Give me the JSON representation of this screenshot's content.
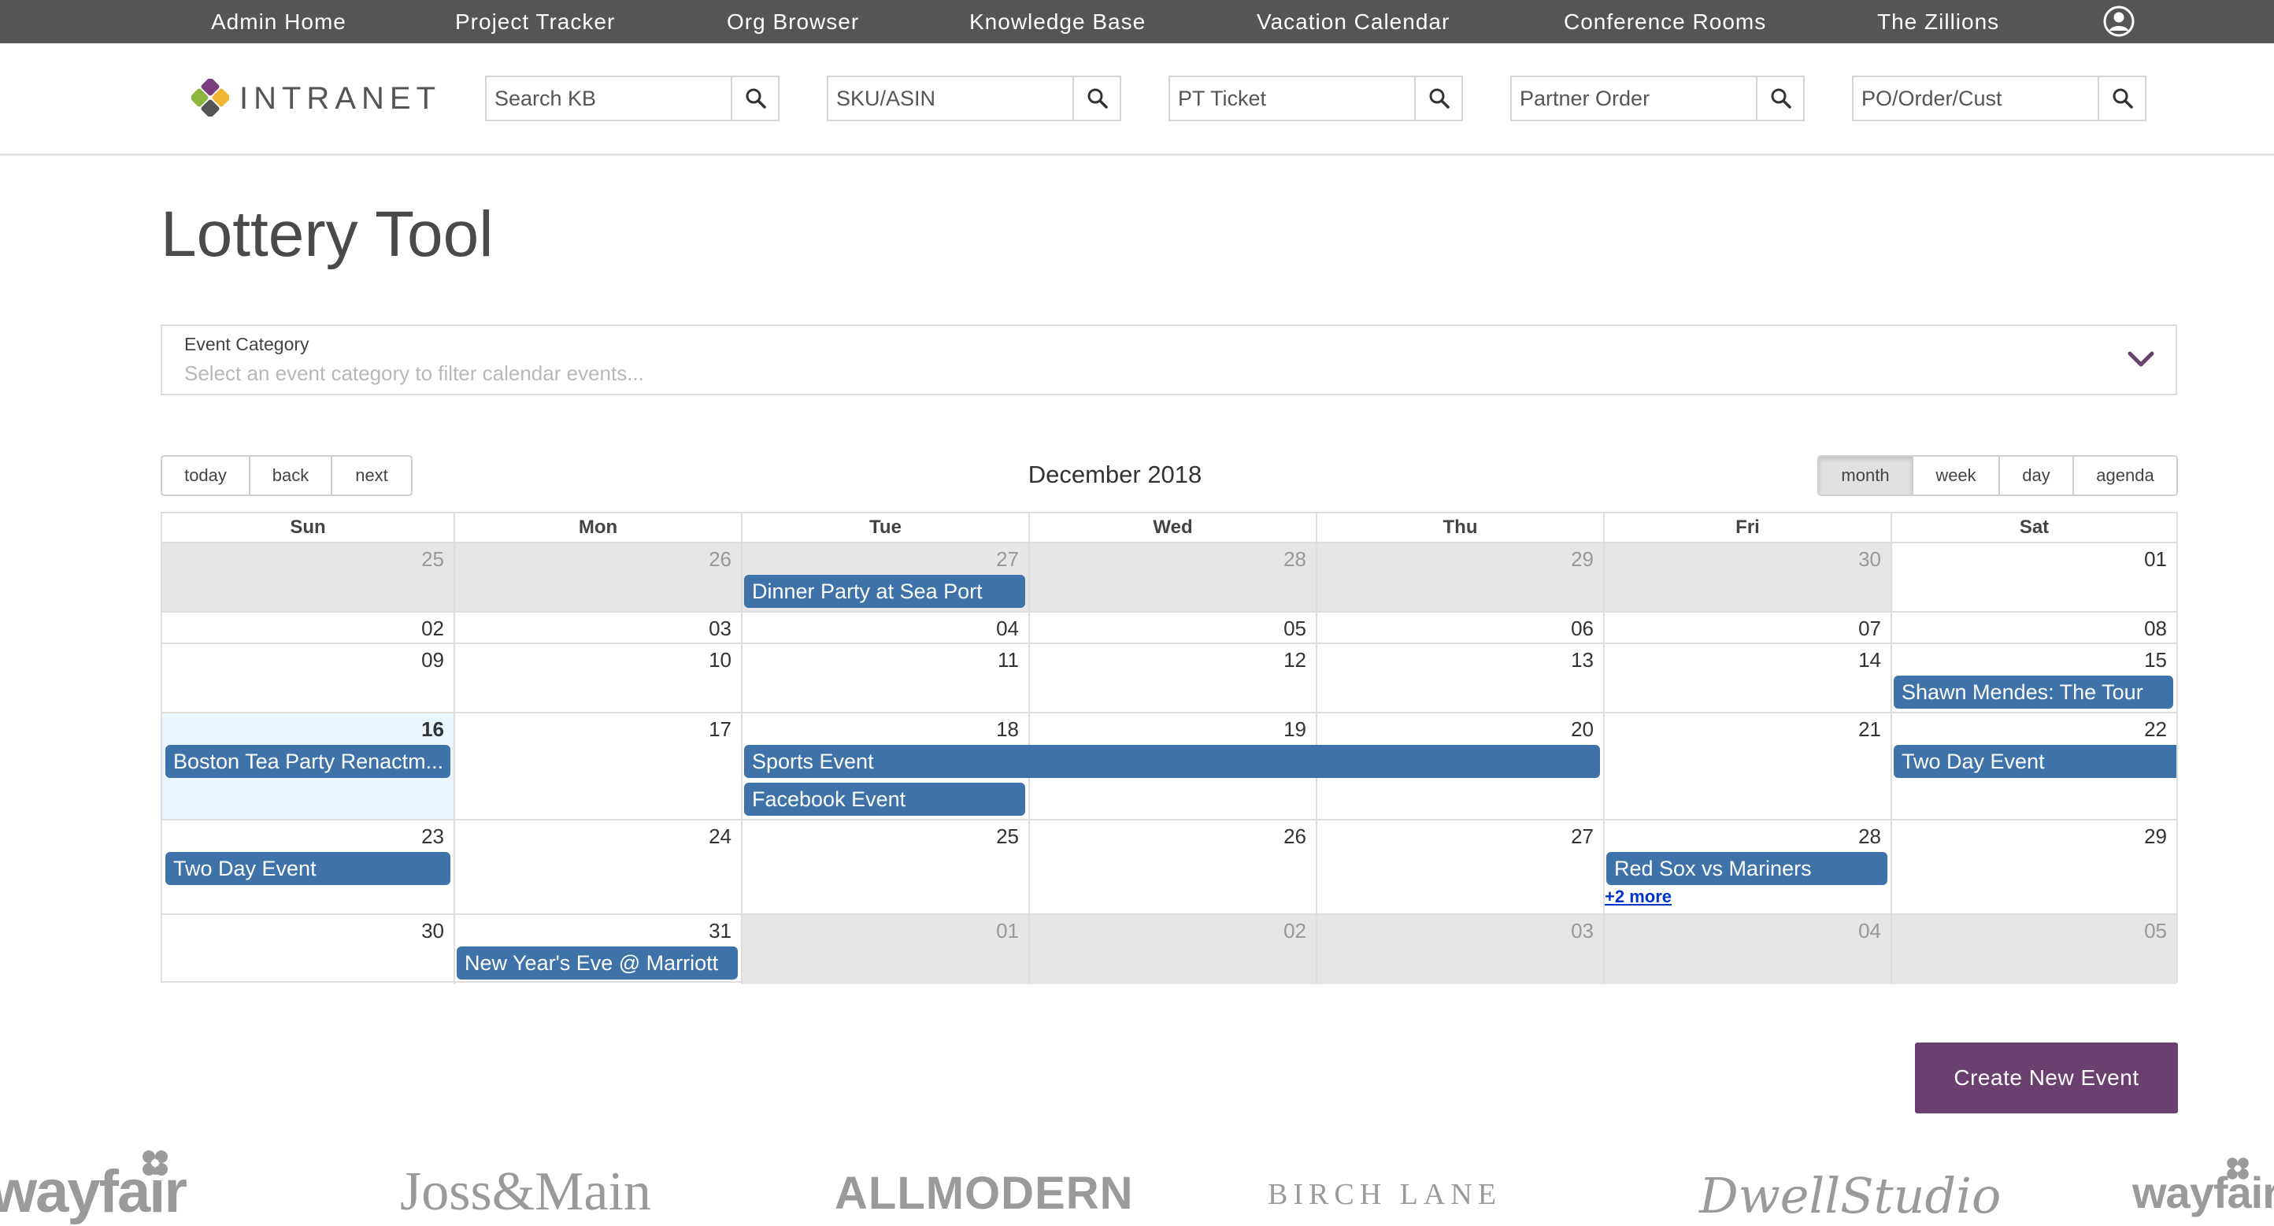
{
  "topnav": {
    "links": [
      "Admin Home",
      "Project Tracker",
      "Org Browser",
      "Knowledge Base",
      "Vacation Calendar",
      "Conference Rooms",
      "The Zillions"
    ],
    "user_icon": "user-icon"
  },
  "header": {
    "logo_text": "INTRANET",
    "searches": [
      {
        "placeholder": "Search KB",
        "icon": "search-icon"
      },
      {
        "placeholder": "SKU/ASIN",
        "icon": "search-icon"
      },
      {
        "placeholder": "PT Ticket",
        "icon": "search-icon"
      },
      {
        "placeholder": "Partner Order",
        "icon": "search-icon"
      },
      {
        "placeholder": "PO/Order/Cust",
        "icon": "search-icon"
      }
    ]
  },
  "page": {
    "title": "Lottery Tool"
  },
  "category": {
    "label": "Event Category",
    "placeholder": "Select an event category to filter calendar events...",
    "icon": "chevron-down-icon"
  },
  "toolbar": {
    "nav": [
      "today",
      "back",
      "next"
    ],
    "label": "December 2018",
    "views": [
      "month",
      "week",
      "day",
      "agenda"
    ],
    "active_view": "month"
  },
  "calendar": {
    "weekdays": [
      "Sun",
      "Mon",
      "Tue",
      "Wed",
      "Thu",
      "Fri",
      "Sat"
    ],
    "today": "16",
    "weeks": [
      {
        "days": [
          {
            "d": "25",
            "off": true
          },
          {
            "d": "26",
            "off": true
          },
          {
            "d": "27",
            "off": true
          },
          {
            "d": "28",
            "off": true
          },
          {
            "d": "29",
            "off": true
          },
          {
            "d": "30",
            "off": true
          },
          {
            "d": "01",
            "off": false
          }
        ],
        "events": [
          {
            "title": "Dinner Party at Sea Port",
            "col": 2,
            "span": 1,
            "lane": 0
          }
        ]
      },
      {
        "days": [
          {
            "d": "02",
            "off": false
          },
          {
            "d": "03",
            "off": false
          },
          {
            "d": "04",
            "off": false
          },
          {
            "d": "05",
            "off": false
          },
          {
            "d": "06",
            "off": false
          },
          {
            "d": "07",
            "off": false
          },
          {
            "d": "08",
            "off": false
          }
        ],
        "events": []
      },
      {
        "days": [
          {
            "d": "09",
            "off": false
          },
          {
            "d": "10",
            "off": false
          },
          {
            "d": "11",
            "off": false
          },
          {
            "d": "12",
            "off": false
          },
          {
            "d": "13",
            "off": false
          },
          {
            "d": "14",
            "off": false
          },
          {
            "d": "15",
            "off": false
          }
        ],
        "events": [
          {
            "title": "Shawn Mendes: The Tour",
            "col": 6,
            "span": 1,
            "lane": 0
          }
        ]
      },
      {
        "days": [
          {
            "d": "16",
            "off": false
          },
          {
            "d": "17",
            "off": false
          },
          {
            "d": "18",
            "off": false
          },
          {
            "d": "19",
            "off": false
          },
          {
            "d": "20",
            "off": false
          },
          {
            "d": "21",
            "off": false
          },
          {
            "d": "22",
            "off": false
          }
        ],
        "events": [
          {
            "title": "Boston Tea Party Renactm...",
            "col": 0,
            "span": 1,
            "lane": 0
          },
          {
            "title": "Sports Event",
            "col": 2,
            "span": 3,
            "lane": 0
          },
          {
            "title": "Two Day Event",
            "col": 6,
            "span": 1,
            "lane": 0,
            "continues": true
          },
          {
            "title": "Facebook Event",
            "col": 2,
            "span": 1,
            "lane": 1
          }
        ]
      },
      {
        "days": [
          {
            "d": "23",
            "off": false
          },
          {
            "d": "24",
            "off": false
          },
          {
            "d": "25",
            "off": false
          },
          {
            "d": "26",
            "off": false
          },
          {
            "d": "27",
            "off": false
          },
          {
            "d": "28",
            "off": false
          },
          {
            "d": "29",
            "off": false
          }
        ],
        "events": [
          {
            "title": "Two Day Event",
            "col": 0,
            "span": 1,
            "lane": 0
          },
          {
            "title": "Red Sox vs Mariners",
            "col": 5,
            "span": 1,
            "lane": 0
          }
        ],
        "more": [
          {
            "label": "+2 more",
            "col": 5
          }
        ]
      },
      {
        "days": [
          {
            "d": "30",
            "off": false
          },
          {
            "d": "31",
            "off": false
          },
          {
            "d": "01",
            "off": true
          },
          {
            "d": "02",
            "off": true
          },
          {
            "d": "03",
            "off": true
          },
          {
            "d": "04",
            "off": true
          },
          {
            "d": "05",
            "off": true
          }
        ],
        "events": [
          {
            "title": "New Year's Eve @ Marriott",
            "col": 1,
            "span": 1,
            "lane": 0
          }
        ]
      }
    ]
  },
  "actions": {
    "create_label": "Create New Event"
  },
  "brands": {
    "wayfair": "wayfair",
    "joss_main": "Joss&Main",
    "allmodern": "ALLMODERN",
    "birch_lane": "BIRCH LANE",
    "dwell": "DwellStudio",
    "wayfair_repeat": "wayfair"
  },
  "colors": {
    "topnav_bg": "#555555",
    "event_blue": "#3f72a8",
    "create_purple": "#6b3f6f",
    "today_bg": "#eaf6ff",
    "off_range_bg": "#e6e6e6",
    "more_link": "#0033cc",
    "chevron_purple": "#6b3f6f"
  }
}
